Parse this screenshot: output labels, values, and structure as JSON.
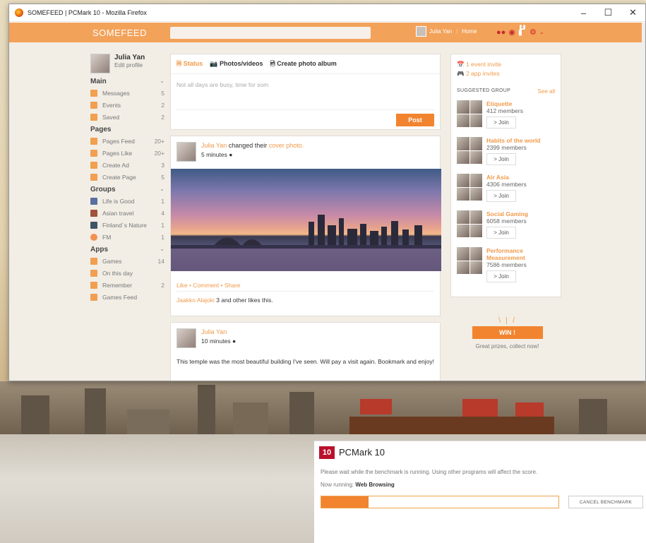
{
  "window": {
    "title": "SOMEFEED | PCMark 10 - Mozilla Firefox",
    "minimize": "–",
    "maximize": "☐",
    "close": "✕"
  },
  "topbar": {
    "logo": "SOMEFEED",
    "user_name": "Julia Yan",
    "home_label": "Home",
    "notification_count": "2"
  },
  "profile": {
    "name": "Julia Yan",
    "edit": "Edit profile"
  },
  "sidebar": {
    "sections": [
      {
        "title": "Main",
        "items": [
          {
            "label": "Messages",
            "count": "5"
          },
          {
            "label": "Events",
            "count": "2"
          },
          {
            "label": "Saved",
            "count": "2"
          }
        ]
      },
      {
        "title": "Pages",
        "items": [
          {
            "label": "Pages Feed",
            "count": "20+"
          },
          {
            "label": "Pages Like",
            "count": "20+"
          },
          {
            "label": "Create Ad",
            "count": "3"
          },
          {
            "label": "Create Page",
            "count": "5"
          }
        ]
      },
      {
        "title": "Groups",
        "items": [
          {
            "label": "Life is Good",
            "count": "1"
          },
          {
            "label": "Asian travel",
            "count": "4"
          },
          {
            "label": "Finland´s Nature",
            "count": "1"
          },
          {
            "label": "FM",
            "count": "1"
          }
        ]
      },
      {
        "title": "Apps",
        "items": [
          {
            "label": "Games",
            "count": "14"
          },
          {
            "label": "On this day",
            "count": ""
          },
          {
            "label": "Remember",
            "count": "2"
          },
          {
            "label": "Games Feed",
            "count": ""
          }
        ]
      }
    ]
  },
  "composer": {
    "tab_status": "Status",
    "tab_photos": "Photos/videos",
    "tab_album": "Create photo album",
    "placeholder": "Not all days are busy, time for som",
    "post_label": "Post"
  },
  "post1": {
    "author": "Julia Yan",
    "action": " changed their ",
    "target": "cover photo.",
    "time": "5 minutes",
    "actions": "Like • Comment • Share",
    "liker": "Jaakko Alajoki",
    "likes_text": " 3 and other likes this."
  },
  "post2": {
    "author": "Julia Yan",
    "time": "10 minutes",
    "text": "This temple was the most beautiful building I've seen. Will pay a visit again. Bookmark and enjoy!"
  },
  "rightcol": {
    "event_invite": "1 event invite",
    "app_invites": "2 app invites",
    "suggested_title": "SUGGESTED GROUP",
    "see_all": "See all",
    "join_label": "> Join",
    "groups": [
      {
        "name": "Etiquette",
        "members": "412 members"
      },
      {
        "name": "Habits of the world",
        "members": "2399 members"
      },
      {
        "name": "Air Asia",
        "members": "4306 members"
      },
      {
        "name": "Social Gaming",
        "members": "6058 members"
      },
      {
        "name": "Performance Measurement",
        "members": "7586 members"
      }
    ]
  },
  "promo": {
    "ribbon": "WIN !",
    "text": "Great prizes, collect now!"
  },
  "pcmark": {
    "logo": "10",
    "title": "PCMark 10",
    "message": "Please wait while the benchmark is running. Using other programs will affect the score.",
    "running_label": "Now running:",
    "running_value": "Web Browsing",
    "progress": 0.2,
    "cancel_label": "CANCEL BENCHMARK"
  },
  "colors": {
    "accent": "#f2842f",
    "topbar": "#f3a25a",
    "pcmark_brand": "#b9112c"
  }
}
